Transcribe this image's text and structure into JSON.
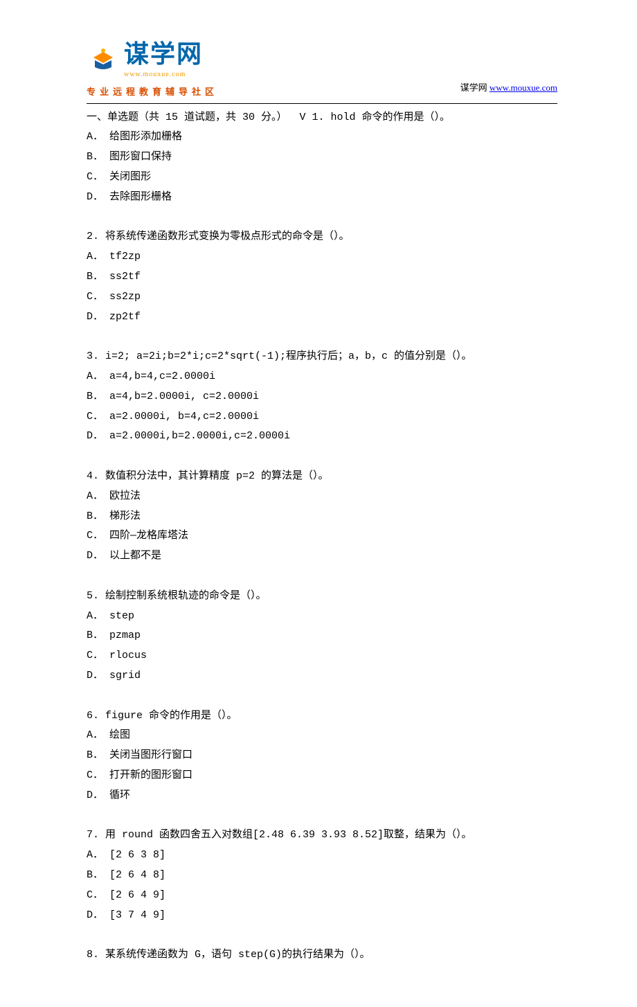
{
  "header": {
    "logo_text": "谋学网",
    "logo_pinyin": "www.mouxue.com",
    "logo_subtitle": "专业远程教育辅导社区",
    "site_label": "谋学网",
    "site_url_text": "www.mouxue.com",
    "site_url": "www.mouxue.com"
  },
  "section_header": "一、单选题（共 15 道试题，共 30 分。）  V 1. hold 命令的作用是（）。",
  "questions": [
    {
      "stem": null,
      "options": [
        "A． 给图形添加栅格",
        "B． 图形窗口保持",
        "C． 关闭图形",
        "D． 去除图形栅格"
      ]
    },
    {
      "stem": "2.   将系统传递函数形式变换为零极点形式的命令是（）。",
      "options": [
        "A． tf2zp",
        "B． ss2tf",
        "C． ss2zp",
        "D． zp2tf"
      ]
    },
    {
      "stem": "3.   i=2; a=2i;b=2*i;c=2*sqrt(-1);程序执行后；a，b，c 的值分别是（）。",
      "options": [
        "A． a=4,b=4,c=2.0000i",
        "B． a=4,b=2.0000i, c=2.0000i",
        "C． a=2.0000i, b=4,c=2.0000i",
        "D． a=2.0000i,b=2.0000i,c=2.0000i"
      ]
    },
    {
      "stem": "4.   数值积分法中，其计算精度 p=2 的算法是（）。",
      "options": [
        "A． 欧拉法",
        "B． 梯形法",
        "C． 四阶—龙格库塔法",
        "D． 以上都不是"
      ]
    },
    {
      "stem": "5.   绘制控制系统根轨迹的命令是（）。",
      "options": [
        "A． step",
        "B． pzmap",
        "C． rlocus",
        "D． sgrid"
      ]
    },
    {
      "stem": "6.   figure 命令的作用是（）。",
      "options": [
        "A． 绘图",
        "B． 关闭当图形行窗口",
        "C． 打开新的图形窗口",
        "D． 循环"
      ]
    },
    {
      "stem": "7.   用 round 函数四舍五入对数组[2.48 6.39 3.93 8.52]取整，结果为（）。",
      "options": [
        "A． [2 6 3 8]",
        "B． [2 6 4 8]",
        "C． [2 6 4 9]",
        "D． [3 7 4 9]"
      ]
    },
    {
      "stem": "8.   某系统传递函数为 G，语句 step(G)的执行结果为（）。",
      "options": []
    }
  ]
}
